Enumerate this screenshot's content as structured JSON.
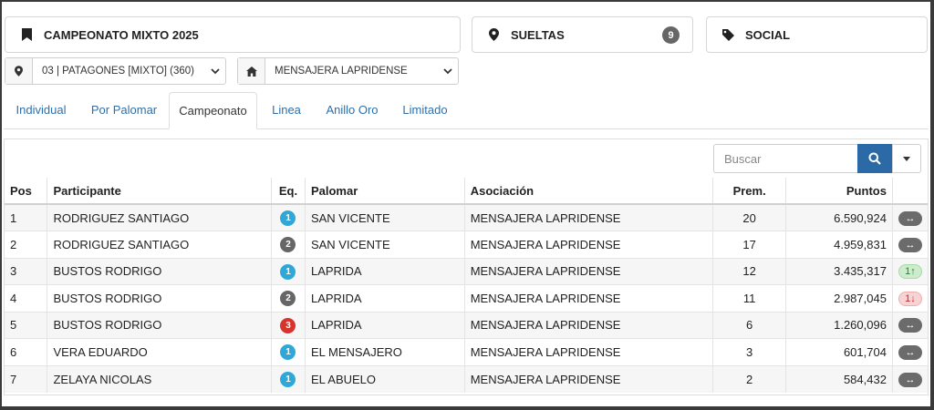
{
  "cards": {
    "championship": {
      "label": "CAMPEONATO MIXTO 2025",
      "icon": "bookmark-icon"
    },
    "sueltas": {
      "label": "SUELTAS",
      "icon": "map-marker-icon",
      "count": "9"
    },
    "social": {
      "label": "SOCIAL",
      "icon": "tag-icon"
    }
  },
  "filters": {
    "location": {
      "value": "03 | PATAGONES [MIXTO] (360)",
      "icon": "map-marker-icon"
    },
    "association": {
      "value": "MENSAJERA LAPRIDENSE",
      "icon": "home-icon"
    }
  },
  "tabs": [
    {
      "label": "Individual",
      "active": false
    },
    {
      "label": "Por Palomar",
      "active": false
    },
    {
      "label": "Campeonato",
      "active": true
    },
    {
      "label": "Linea",
      "active": false
    },
    {
      "label": "Anillo Oro",
      "active": false
    },
    {
      "label": "Limitado",
      "active": false
    }
  ],
  "search": {
    "placeholder": "Buscar"
  },
  "table": {
    "headers": {
      "pos": "Pos",
      "participant": "Participante",
      "eq": "Eq.",
      "loft": "Palomar",
      "association": "Asociación",
      "prem": "Prem.",
      "points": "Puntos"
    },
    "rows": [
      {
        "pos": "1",
        "participant": "RODRIGUEZ SANTIAGO",
        "eq": "1",
        "eq_color": "#2fa8d8",
        "loft": "SAN VICENTE",
        "association": "MENSAJERA LAPRIDENSE",
        "prem": "20",
        "points": "6.590,924",
        "trend": "↔",
        "trend_type": "neutral"
      },
      {
        "pos": "2",
        "participant": "RODRIGUEZ SANTIAGO",
        "eq": "2",
        "eq_color": "#666666",
        "loft": "SAN VICENTE",
        "association": "MENSAJERA LAPRIDENSE",
        "prem": "17",
        "points": "4.959,831",
        "trend": "↔",
        "trend_type": "neutral"
      },
      {
        "pos": "3",
        "participant": "BUSTOS RODRIGO",
        "eq": "1",
        "eq_color": "#2fa8d8",
        "loft": "LAPRIDA",
        "association": "MENSAJERA LAPRIDENSE",
        "prem": "12",
        "points": "3.435,317",
        "trend": "1↑",
        "trend_type": "up"
      },
      {
        "pos": "4",
        "participant": "BUSTOS RODRIGO",
        "eq": "2",
        "eq_color": "#666666",
        "loft": "LAPRIDA",
        "association": "MENSAJERA LAPRIDENSE",
        "prem": "11",
        "points": "2.987,045",
        "trend": "1↓",
        "trend_type": "down"
      },
      {
        "pos": "5",
        "participant": "BUSTOS RODRIGO",
        "eq": "3",
        "eq_color": "#d9342b",
        "loft": "LAPRIDA",
        "association": "MENSAJERA LAPRIDENSE",
        "prem": "6",
        "points": "1.260,096",
        "trend": "↔",
        "trend_type": "neutral"
      },
      {
        "pos": "6",
        "participant": "VERA EDUARDO",
        "eq": "1",
        "eq_color": "#2fa8d8",
        "loft": "EL MENSAJERO",
        "association": "MENSAJERA LAPRIDENSE",
        "prem": "3",
        "points": "601,704",
        "trend": "↔",
        "trend_type": "neutral"
      },
      {
        "pos": "7",
        "participant": "ZELAYA NICOLAS",
        "eq": "1",
        "eq_color": "#2fa8d8",
        "loft": "EL ABUELO",
        "association": "MENSAJERA LAPRIDENSE",
        "prem": "2",
        "points": "584,432",
        "trend": "↔",
        "trend_type": "neutral"
      }
    ]
  }
}
